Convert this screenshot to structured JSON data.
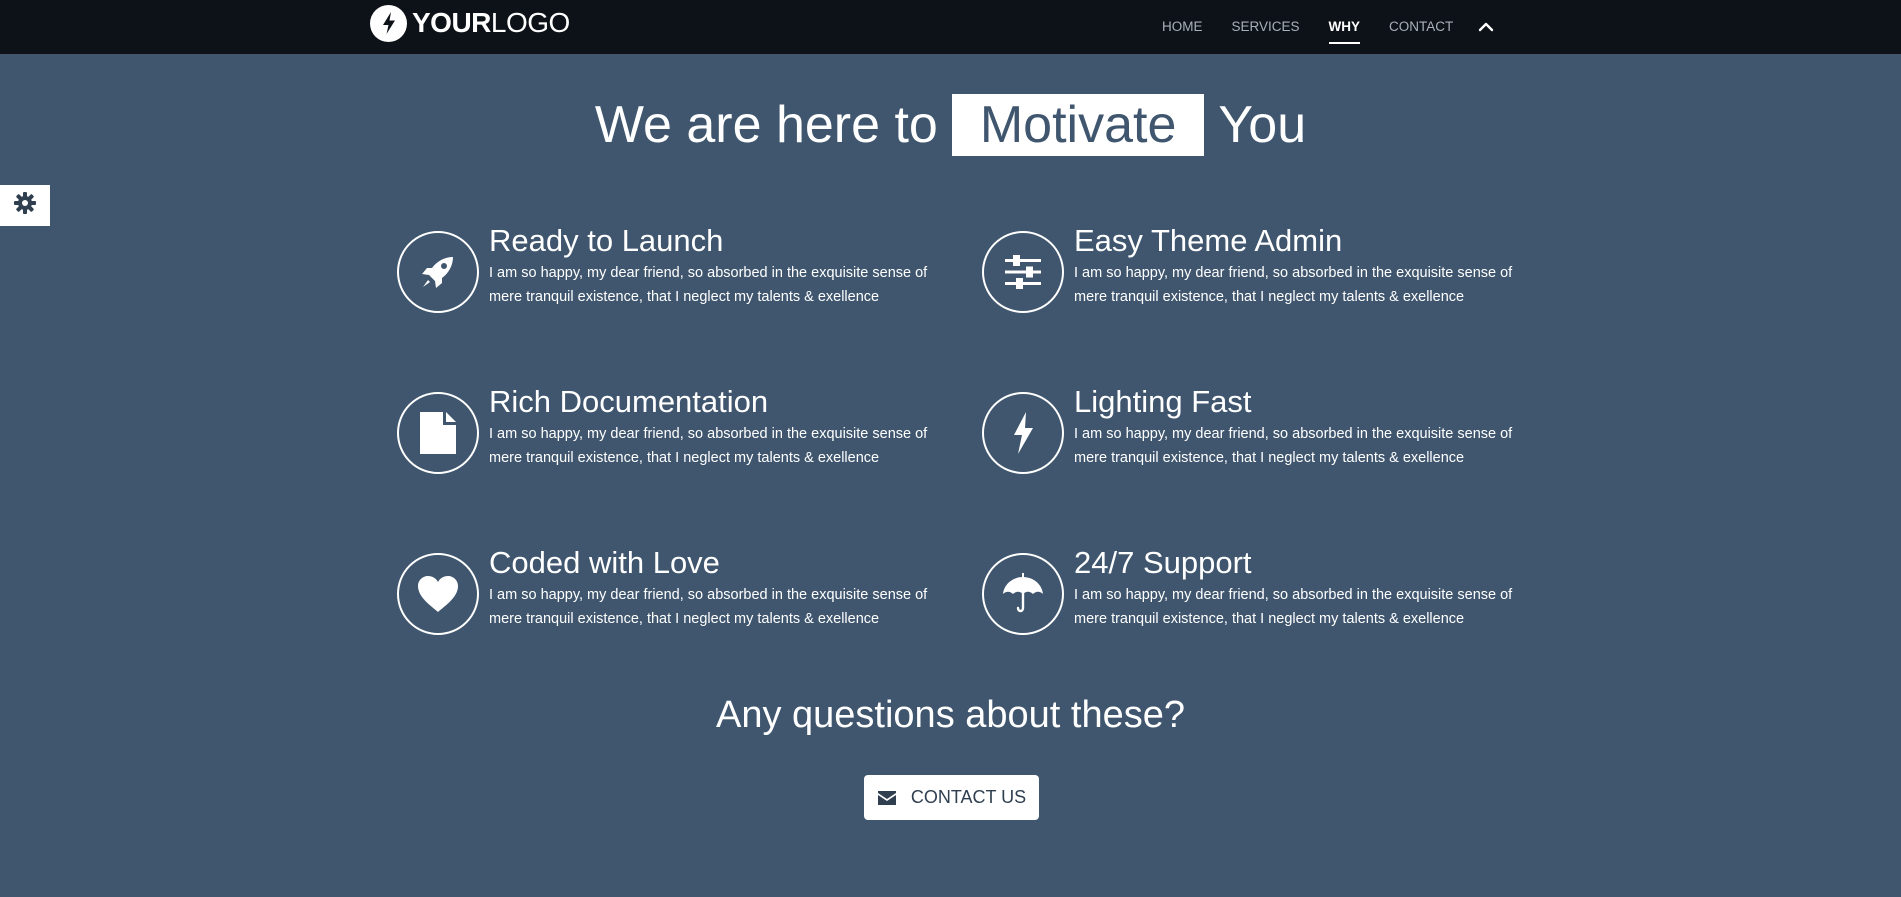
{
  "header": {
    "logo_bold": "YOUR",
    "logo_light": "LOGO",
    "logo_icon": "lightning-icon",
    "nav": [
      {
        "label": "HOME"
      },
      {
        "label": "SERVICES"
      },
      {
        "label": "WHY",
        "active": true
      },
      {
        "label": "CONTACT"
      }
    ],
    "scroll_up_icon": "chevron-up-icon"
  },
  "settings": {
    "icon": "gear-icon"
  },
  "hero": {
    "before": "We are here to",
    "highlight": "Motivate",
    "after": "You"
  },
  "features": [
    {
      "title": "Ready to Launch",
      "icon": "rocket-icon",
      "desc": "I am so happy, my dear friend, so absorbed in the exquisite sense of mere tranquil existence, that I neglect my talents & exellence"
    },
    {
      "title": "Easy Theme Admin",
      "icon": "sliders-icon",
      "desc": "I am so happy, my dear friend, so absorbed in the exquisite sense of mere tranquil existence, that I neglect my talents & exellence"
    },
    {
      "title": "Rich Documentation",
      "icon": "document-icon",
      "desc": "I am so happy, my dear friend, so absorbed in the exquisite sense of mere tranquil existence, that I neglect my talents & exellence"
    },
    {
      "title": "Lighting Fast",
      "icon": "lightning-icon",
      "desc": "I am so happy, my dear friend, so absorbed in the exquisite sense of mere tranquil existence, that I neglect my talents & exellence"
    },
    {
      "title": "Coded with Love",
      "icon": "heart-icon",
      "desc": "I am so happy, my dear friend, so absorbed in the exquisite sense of mere tranquil existence, that I neglect my talents & exellence"
    },
    {
      "title": "24/7 Support",
      "icon": "umbrella-icon",
      "desc": "I am so happy, my dear friend, so absorbed in the exquisite sense of mere tranquil existence, that I neglect my talents & exellence"
    }
  ],
  "cta": {
    "question": "Any questions about these?",
    "button_label": "CONTACT US",
    "button_icon": "envelope-icon"
  },
  "colors": {
    "background": "#3f566e",
    "navbar": "#0d1218",
    "text": "#ffffff"
  }
}
